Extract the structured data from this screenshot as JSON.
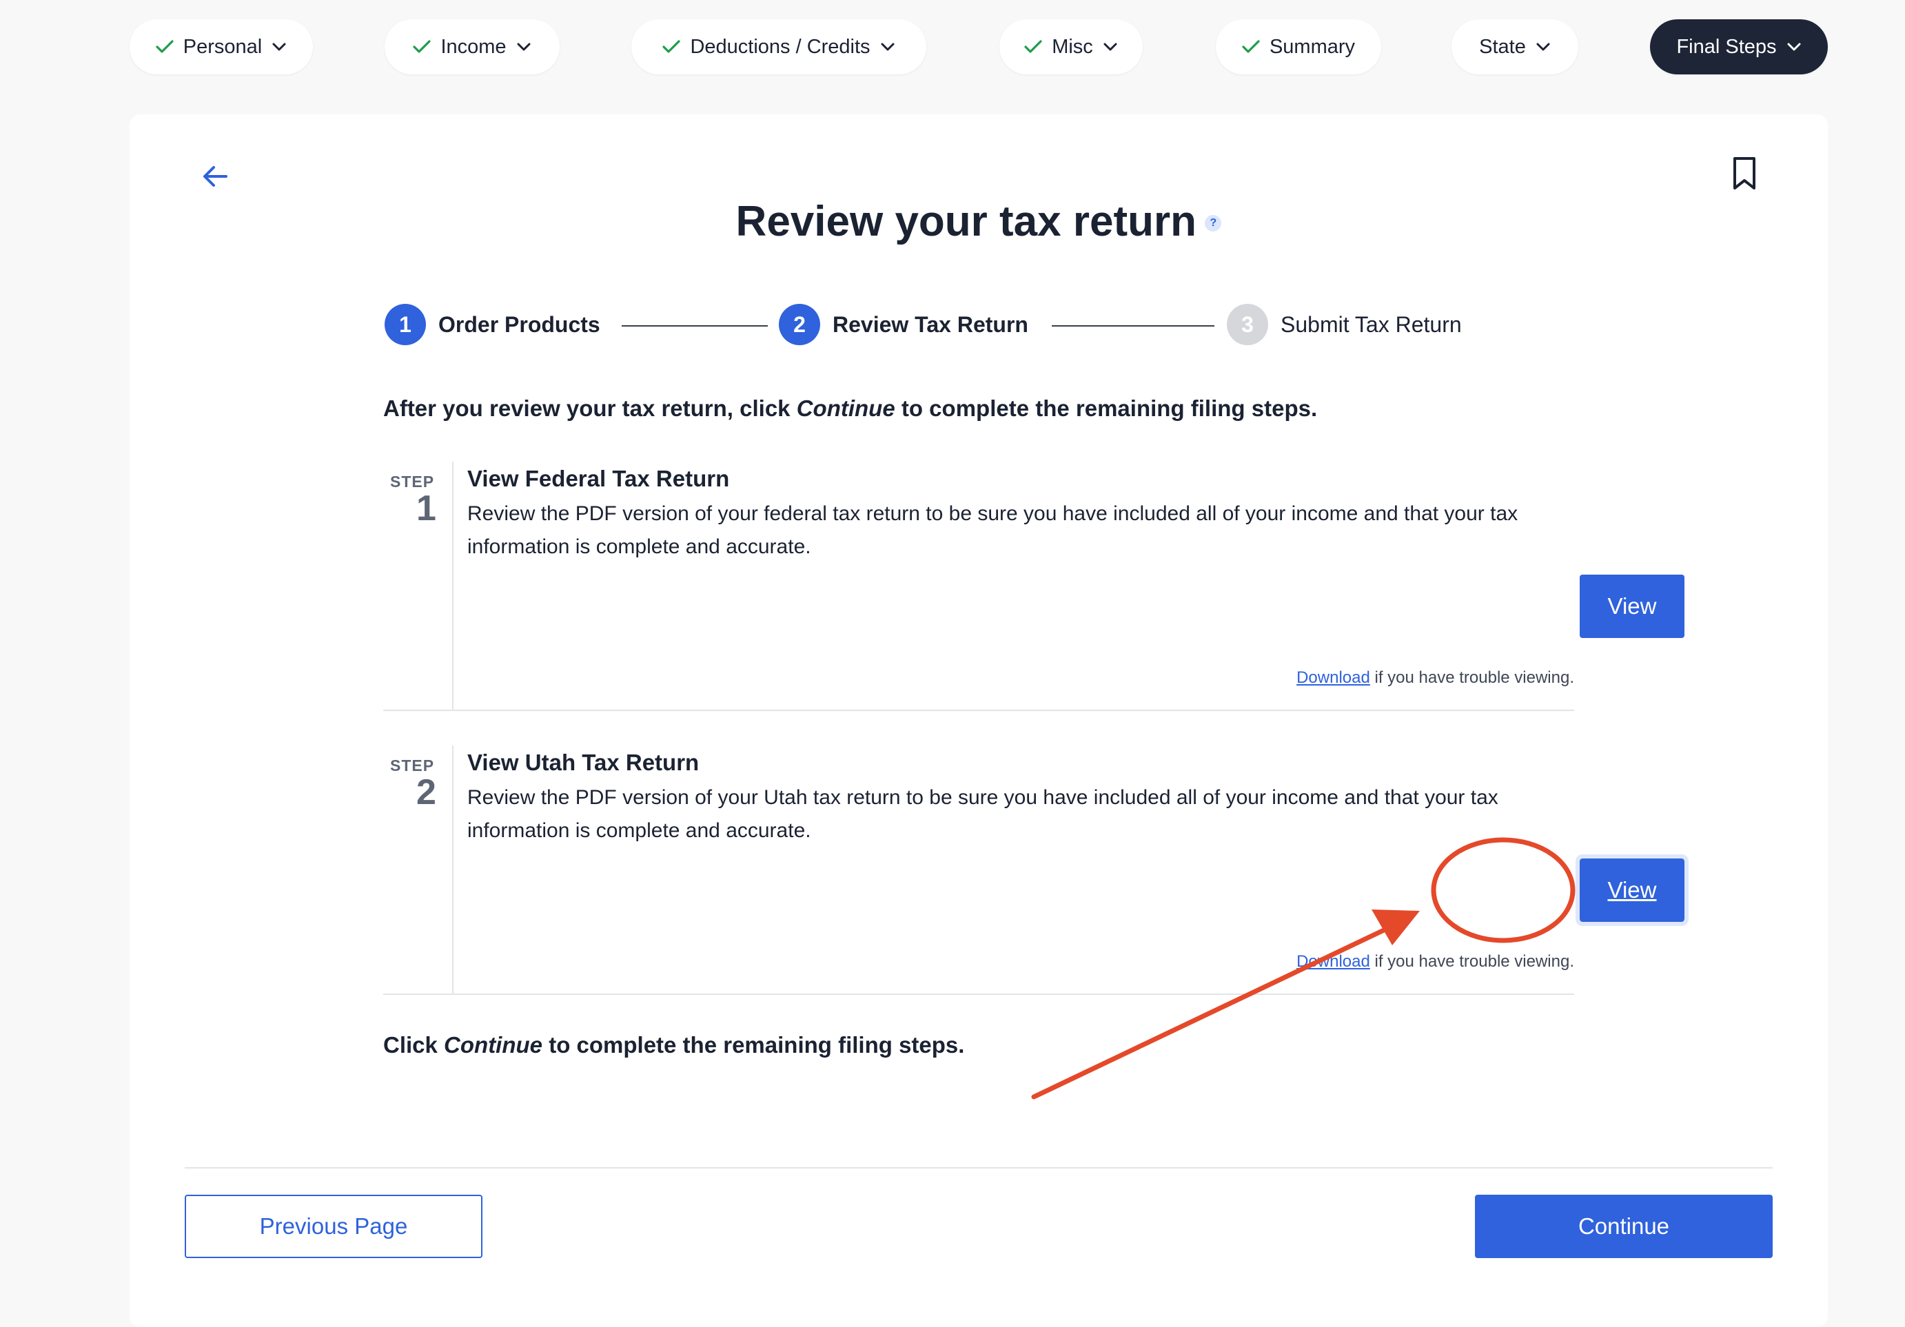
{
  "topnav": {
    "items": [
      {
        "label": "Personal",
        "completed": true,
        "has_dropdown": true
      },
      {
        "label": "Income",
        "completed": true,
        "has_dropdown": true
      },
      {
        "label": "Deductions / Credits",
        "completed": true,
        "has_dropdown": true
      },
      {
        "label": "Misc",
        "completed": true,
        "has_dropdown": true
      },
      {
        "label": "Summary",
        "completed": true,
        "has_dropdown": false
      },
      {
        "label": "State",
        "completed": false,
        "has_dropdown": true
      },
      {
        "label": "Final Steps",
        "completed": false,
        "has_dropdown": true,
        "active": true
      }
    ],
    "check_color": "#1f9d4c",
    "active_color": "#1d2536"
  },
  "page": {
    "title": "Review your tax return",
    "help_glyph": "?"
  },
  "stepper": {
    "steps": [
      {
        "number": "1",
        "label": "Order Products",
        "state": "complete"
      },
      {
        "number": "2",
        "label": "Review Tax Return",
        "state": "current"
      },
      {
        "number": "3",
        "label": "Submit Tax Return",
        "state": "upcoming"
      }
    ]
  },
  "intro": {
    "before": "After you review your tax return, click ",
    "emphasis": "Continue",
    "after": " to complete the remaining filing steps."
  },
  "sections": [
    {
      "step_word": "STEP",
      "step_number": "1",
      "title": "View Federal Tax Return",
      "description": "Review the PDF version of your federal tax return to be sure you have included all of your income and that your tax information is complete and accurate.",
      "button_label": "View",
      "download_link": "Download",
      "download_suffix": " if you have trouble viewing."
    },
    {
      "step_word": "STEP",
      "step_number": "2",
      "title": "View Utah Tax Return",
      "description": "Review the PDF version of your Utah tax return to be sure you have included all of your income and that your tax information is complete and accurate.",
      "button_label": "View",
      "download_link": "Download",
      "download_suffix": " if you have trouble viewing."
    }
  ],
  "outro": {
    "before": "Click ",
    "emphasis": "Continue",
    "after": " to complete the remaining filing steps."
  },
  "footer": {
    "previous_label": "Previous Page",
    "continue_label": "Continue"
  },
  "colors": {
    "primary": "#2f62dc",
    "annotation": "#e4492a",
    "text": "#1b2232"
  },
  "icons": {
    "back": "arrow-left-icon",
    "bookmark": "bookmark-icon",
    "check": "check-icon",
    "chevron": "chevron-down-icon",
    "help": "help-icon"
  }
}
